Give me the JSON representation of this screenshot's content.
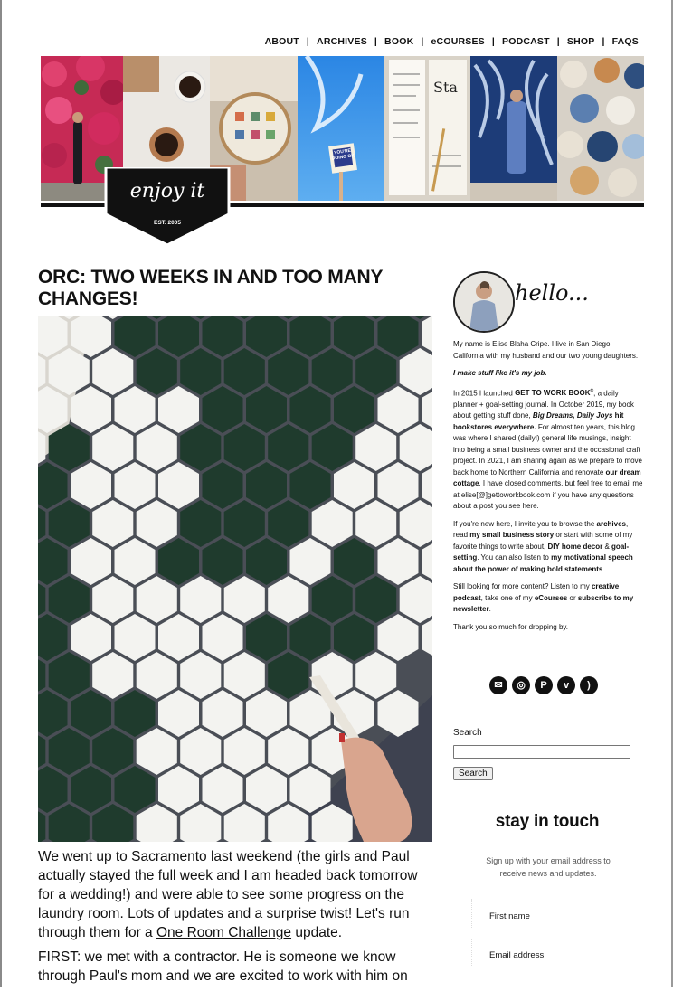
{
  "nav": {
    "items": [
      "ABOUT",
      "ARCHIVES",
      "BOOK",
      "eCOURSES",
      "PODCAST",
      "SHOP",
      "FAQS"
    ],
    "separator": "|"
  },
  "logo": {
    "script_text": "enjoy it",
    "est_text": "EST. 2005"
  },
  "banner": {
    "sign_text": "YOU'RE DOING OK"
  },
  "post": {
    "title": "ORC: TWO WEEKS IN AND TOO MANY CHANGES!",
    "para1_text": "We went up to Sacramento last weekend (the girls and Paul actually stayed the full week and I am headed back tomorrow for a wedding!) and were able to see some progress on the laundry room. Lots of updates and a surprise twist! Let's run through them for a ",
    "para1_link": "One Room Challenge",
    "para1_end": " update.",
    "para2_text": "FIRST: we met with a contractor. He is someone we know through Paul's mom and we are excited to work with him on"
  },
  "sidebar": {
    "hello_text": "hello...",
    "bio_p1": "My name is Elise Blaha Cripe. I live in San Diego, California with my husband and our two young daughters.",
    "bio_p2": "I make stuff like it's my job.",
    "bio_p3_a": "In 2015 I launched ",
    "bio_p3_b": "GET TO WORK BOOK",
    "bio_p3_reg": "®",
    "bio_p3_c": ", a daily planner + goal-setting journal. In October 2019, my book about getting stuff done, ",
    "bio_p3_d": "Big Dreams, Daily Joys",
    "bio_p3_e": " hit bookstores everywhere.",
    "bio_p3_f": " For almost ten years, this blog was where I shared (daily!) general life musings, insight into being a small business owner and the occasional craft project. In 2021, I am sharing again as we prepare to move back home to Northern California and renovate ",
    "bio_p3_g": "our dream cottage",
    "bio_p3_h": ". I have closed comments, but feel free to email me at elise[@]gettoworkbook.com if you have any questions about a post you see here.",
    "bio_p4_a": "If you're new here, I invite you to browse the ",
    "bio_p4_b": "archives",
    "bio_p4_c": ", read ",
    "bio_p4_d": "my small business story",
    "bio_p4_e": " or start with some of my favorite things to write about, ",
    "bio_p4_f": "DIY home decor",
    "bio_p4_g": " & ",
    "bio_p4_h": "goal-setting",
    "bio_p4_i": ". You can also listen to ",
    "bio_p4_j": "my motivational speech about the power of making bold statements",
    "bio_p4_k": ".",
    "bio_p5_a": "Still looking for more content? Listen to my ",
    "bio_p5_b": "creative podcast",
    "bio_p5_c": ", take one of my ",
    "bio_p5_d": "eCourses",
    "bio_p5_e": " or ",
    "bio_p5_f": "subscribe to my newsletter",
    "bio_p5_g": ".",
    "bio_p6": "Thank you so much for dropping by.",
    "socials": [
      "email-icon",
      "instagram-icon",
      "pinterest-icon",
      "vimeo-icon",
      "rss-icon"
    ],
    "search_label": "Search",
    "search_button": "Search",
    "stay_title": "stay in touch",
    "stay_sub": "Sign up with your email address to receive news and updates.",
    "first_name_label": "First name",
    "email_label": "Email address"
  },
  "colors": {
    "tile_green": "#1f3b2d",
    "tile_white": "#f3f3f0",
    "grout": "#4a4e56",
    "text": "#111111"
  }
}
